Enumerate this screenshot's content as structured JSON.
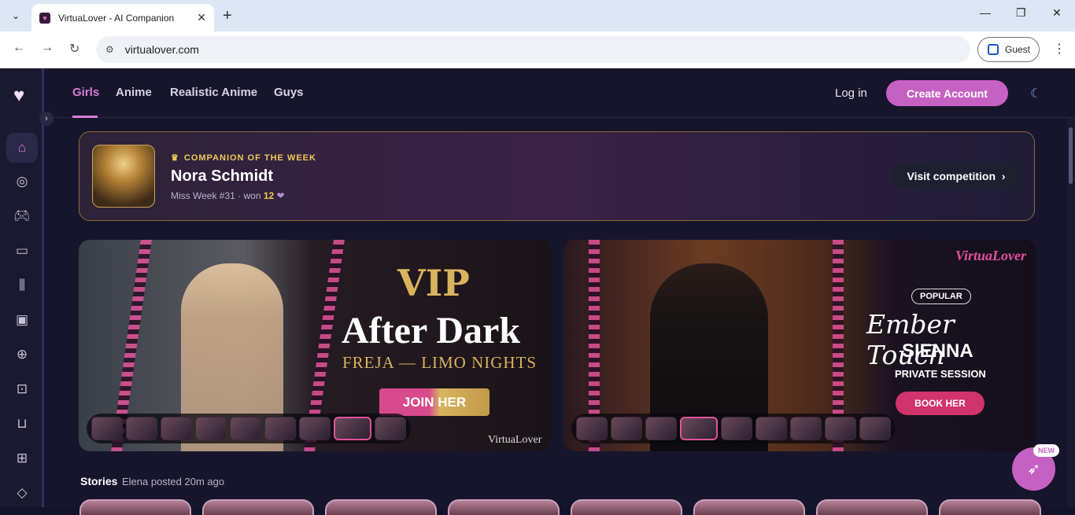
{
  "browser": {
    "tab_title": "VirtuaLover - AI Companion",
    "url": "virtualover.com",
    "profile_label": "Guest"
  },
  "sidebar": {
    "items": [
      {
        "name": "home-icon",
        "glyph": "⌂"
      },
      {
        "name": "compass-icon",
        "glyph": "◎"
      },
      {
        "name": "gamepad-icon",
        "glyph": "🎮︎"
      },
      {
        "name": "chat-icon",
        "glyph": "▭"
      },
      {
        "name": "library-icon",
        "glyph": "⫼"
      },
      {
        "name": "image-icon",
        "glyph": "▣"
      },
      {
        "name": "plus-circle-icon",
        "glyph": "⊕"
      },
      {
        "name": "bot-icon",
        "glyph": "⊡"
      },
      {
        "name": "bag-icon",
        "glyph": "⊔"
      },
      {
        "name": "gift-icon",
        "glyph": "⊞"
      },
      {
        "name": "tag-icon",
        "glyph": "◇"
      }
    ]
  },
  "nav": {
    "tabs": [
      "Girls",
      "Anime",
      "Realistic Anime",
      "Guys"
    ],
    "login": "Log in",
    "create_account": "Create Account"
  },
  "cotw": {
    "label": "COMPANION OF THE WEEK",
    "name": "Nora Schmidt",
    "sub_prefix": "Miss Week #31 · won ",
    "won": "12",
    "visit": "Visit competition"
  },
  "banner1": {
    "vip": "VIP",
    "title": "After Dark",
    "subtitle": "FREJA — LIMO NIGHTS",
    "cta": "JOIN HER",
    "brand": "VirtuaLover"
  },
  "banner2": {
    "brand_a": "Virtua",
    "brand_b": "Lover",
    "badge": "POPULAR",
    "title": "Ember Touch",
    "name": "SIENNA",
    "session": "PRIVATE SESSION",
    "cta": "BOOK HER"
  },
  "stories": {
    "label": "Stories",
    "sub": "Elena posted 20m ago"
  },
  "fab": {
    "badge": "NEW"
  }
}
